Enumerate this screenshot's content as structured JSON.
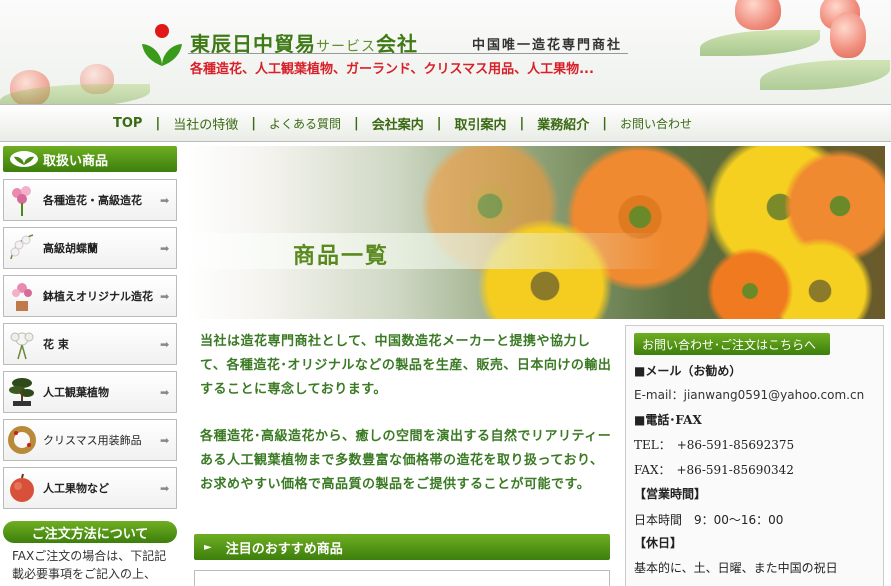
{
  "header": {
    "company_name": "東辰日中貿易",
    "company_suffix": "サービス",
    "company_end": "会社",
    "tagline": "中国唯一造花専門商社",
    "products_line": "各種造花、人工観葉植物、ガーランド、クリスマス用品、人工果物..."
  },
  "nav": {
    "items": [
      "TOP",
      "当社の特徴",
      "よくある質問",
      "会社案内",
      "取引案内",
      "業務紹介",
      "お問い合わせ"
    ],
    "separator": "|"
  },
  "sidebar": {
    "title": "取扱い商品",
    "categories": [
      {
        "label": "各種造花・高級造花",
        "icon": "flower-bouquet-icon"
      },
      {
        "label": "高級胡蝶蘭",
        "icon": "orchid-icon"
      },
      {
        "label": "鉢植えオリジナル造花",
        "icon": "potted-flower-icon"
      },
      {
        "label": "花 束",
        "icon": "bouquet-icon"
      },
      {
        "label": "人工観葉植物",
        "icon": "bonsai-icon"
      },
      {
        "label": "クリスマス用装飾品",
        "icon": "wreath-icon"
      },
      {
        "label": "人工果物など",
        "icon": "apple-icon"
      }
    ],
    "arrow": "➡",
    "order_method": "ご注文方法について",
    "fax_note": "FAXご注文の場合は、下記記載必要事項をご記入の上、"
  },
  "banner": {
    "title": "商品一覧"
  },
  "main": {
    "intro1": "当社は造花専門商社として、中国数造花メーカーと提携や協力して、各種造花･オリジナルなどの製品を生産、販売、日本向けの輸出することに専念しております。",
    "intro2": "各種造花･高級造花から、癒しの空間を演出する自然でリアリティーある人工観葉植物まで多数豊富な価格帯の造花を取り扱っており、お求めやすい価格で高品質の製品をご提供することが可能です。",
    "recommend_title": "注目のおすすめ商品",
    "recommend_marker": "►"
  },
  "contact": {
    "title": "お問い合わせ･ご注文はこちらへ",
    "mail_heading": "■メール（お勧め）",
    "email_line": "E-mail：jianwang0591@yahoo.com.cn",
    "phone_heading": "■電話･FAX",
    "tel_line": "TEL：　+86-591-85692375",
    "fax_line": "FAX：　+86-591-85690342",
    "hours_heading": "【営業時間】",
    "hours_line": "日本時間　9：00～16：00",
    "holiday_heading": "【休日】",
    "holiday_line": "基本的に、土、日曜、また中国の祝日"
  },
  "colors": {
    "accent_green": "#4a8a14",
    "text_green": "#3b7a24",
    "red": "#d8202a"
  }
}
